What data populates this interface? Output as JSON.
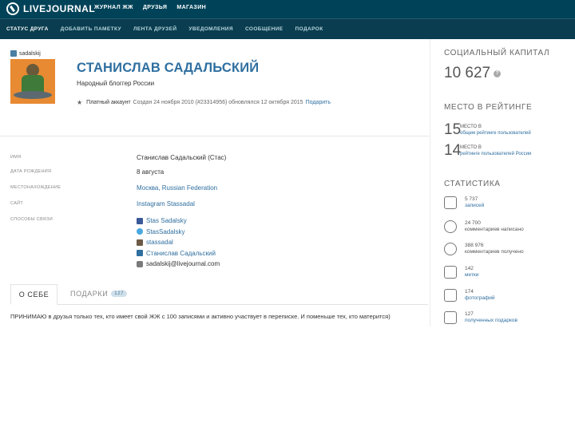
{
  "topbar": {
    "logo": "LIVEJOURNAL",
    "nav": [
      "ЖУРНАЛ ЖЖ",
      "ДРУЗЬЯ",
      "МАГАЗИН"
    ]
  },
  "subnav": [
    "СТАТУС ДРУГА",
    "ДОБАВИТЬ ПАМЕТКУ",
    "ЛЕНТА ДРУЗЕЙ",
    "УВЕДОМЛЕНИЯ",
    "СООБЩЕНИЕ",
    "ПОДАРОК"
  ],
  "profile": {
    "username": "sadalskij",
    "name": "СТАНИСЛАВ САДАЛЬСКИЙ",
    "role": "Народный блоггер России",
    "account": {
      "type": "Платный аккаунт",
      "details": "Создан 24 ноября 2010 (#23314956) обновлялся 12 октября 2015",
      "link": "Подарить"
    }
  },
  "info": {
    "name_label": "ИМЯ",
    "name_value": "Станислав Садальский (Стас)",
    "birthday_label": "ДАТА РОЖДЕНИЯ",
    "birthday_value": "8 августа",
    "location_label": "МЕСТОНАХОЖДЕНИЕ",
    "location_value": "Москва, Russian Federation",
    "site_label": "САЙТ",
    "site_value": "Instagram Stassadal",
    "contacts_label": "СПОСОБЫ СВЯЗИ",
    "contacts": [
      "Stas Sadalsky",
      "StasSadalsky",
      "stassadal",
      "Станислав Садальский",
      "sadalskij@livejournal.com"
    ]
  },
  "tabs": {
    "about": "О СЕБЕ",
    "gifts": "ПОДАРКИ",
    "gifts_count": "127"
  },
  "about_text": "ПРИНИМАЮ в друзья только тех, кто имеет свой ЖЖ с 100 записями и активно участвует в переписке. И поменьше тех, кто матерится)",
  "right": {
    "capital_title": "СОЦИАЛЬНЫЙ КАПИТАЛ",
    "capital_value": "10 627",
    "rating_title": "МЕСТО В РЕЙТИНГЕ",
    "rank1_num": "15",
    "rank1_label": "МЕСТО В",
    "rank1_link": "общем рейтинге пользователей",
    "rank2_num": "14",
    "rank2_label": "МЕСТО В",
    "rank2_link": "рейтинге пользователей России",
    "stats_title": "СТАТИСТИКА",
    "stats": [
      {
        "value": "5 737",
        "label": "записей",
        "link": true
      },
      {
        "value": "24 700",
        "label": "комментариев написано",
        "link": false
      },
      {
        "value": "388 976",
        "label": "комментариев получено",
        "link": false
      },
      {
        "value": "142",
        "label": "метки",
        "link": true
      },
      {
        "value": "174",
        "label": "фотографий",
        "link": true
      },
      {
        "value": "127",
        "label": "полученных подарков",
        "link": true
      }
    ]
  }
}
